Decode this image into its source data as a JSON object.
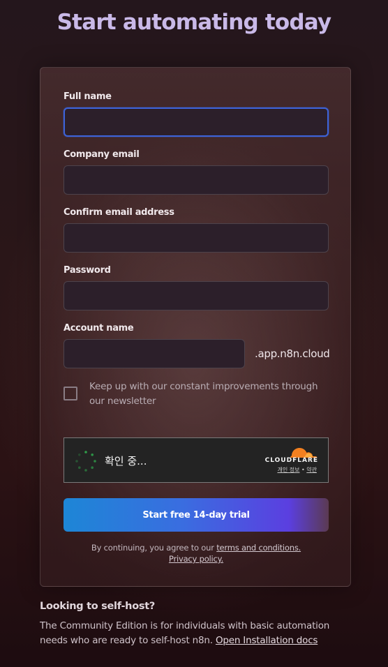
{
  "page": {
    "title": "Start automating today"
  },
  "form": {
    "full_name": {
      "label": "Full name",
      "value": ""
    },
    "company_email": {
      "label": "Company email",
      "value": ""
    },
    "confirm_email": {
      "label": "Confirm email address",
      "value": ""
    },
    "password": {
      "label": "Password",
      "value": ""
    },
    "account_name": {
      "label": "Account name",
      "value": "",
      "suffix": ".app.n8n.cloud"
    },
    "newsletter": {
      "label": "Keep up with our constant improvements through our newsletter",
      "checked": false
    },
    "captcha": {
      "status_text": "확인 중...",
      "brand": "CLOUDFLARE",
      "privacy_link": "개인 정보",
      "separator": "•",
      "terms_link": "약관",
      "brand_color": "#f38020"
    },
    "submit_label": "Start free 14-day trial",
    "terms": {
      "prefix": "By continuing, you agree to our ",
      "terms_link": "terms and conditions.",
      "privacy_link": "Privacy policy."
    }
  },
  "selfhost": {
    "title": "Looking to self-host?",
    "text": "The Community Edition is for individuals with basic automation needs who are ready to self-host n8n. ",
    "link": "Open Installation docs"
  },
  "colors": {
    "title": "#c9b9e8",
    "focus_border": "#3d63d9",
    "button_gradient_start": "#1d86d6",
    "button_gradient_end": "#5b3fe0"
  }
}
